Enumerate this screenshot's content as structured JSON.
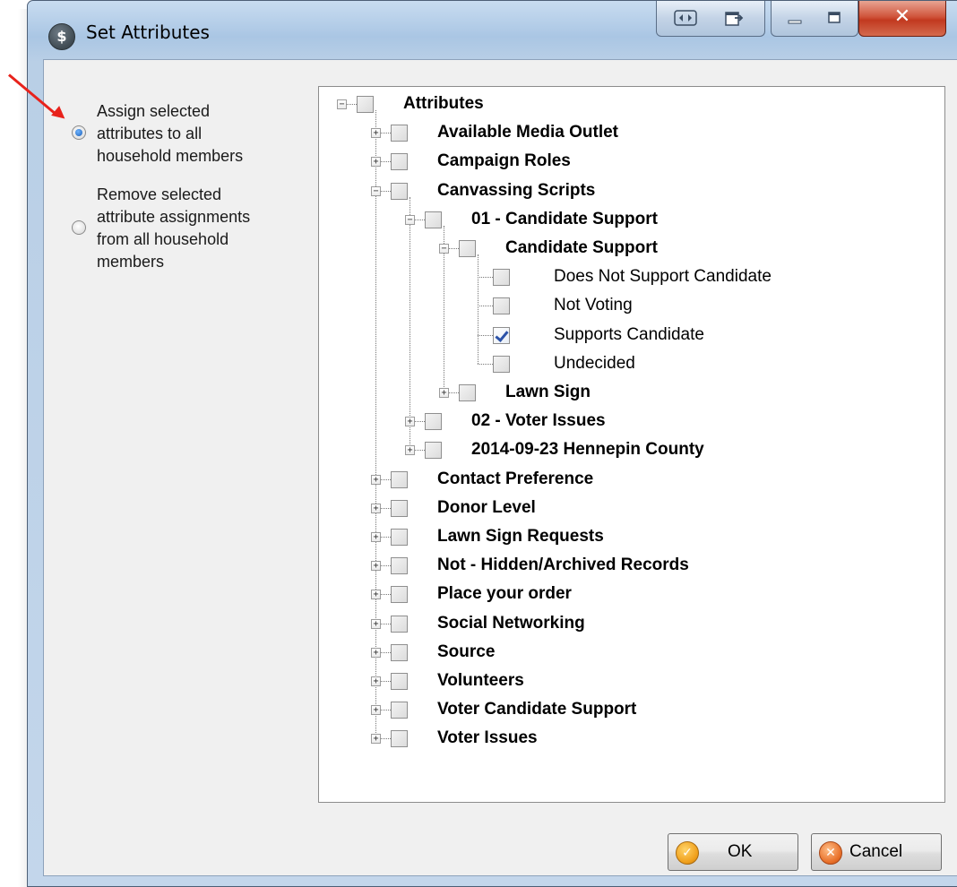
{
  "window": {
    "title": "Set Attributes",
    "app_icon_glyph": "$"
  },
  "options": [
    {
      "label": "Assign selected attributes to all household members",
      "lines": [
        "Assign selected",
        "attributes to all",
        "household members"
      ],
      "checked": true
    },
    {
      "label": "Remove selected attribute assignments from all household members",
      "lines": [
        "Remove selected",
        "attribute assignments",
        "from all household",
        "members"
      ],
      "checked": false
    }
  ],
  "tree": [
    {
      "label": "Attributes",
      "level": 0,
      "expander": "minus",
      "bold": true,
      "checked": false
    },
    {
      "label": "Available Media Outlet",
      "level": 1,
      "expander": "plus",
      "bold": true,
      "checked": false
    },
    {
      "label": "Campaign Roles",
      "level": 1,
      "expander": "plus",
      "bold": true,
      "checked": false
    },
    {
      "label": "Canvassing Scripts",
      "level": 1,
      "expander": "minus",
      "bold": true,
      "checked": false
    },
    {
      "label": "01 - Candidate Support",
      "level": 2,
      "expander": "minus",
      "bold": true,
      "checked": false
    },
    {
      "label": "Candidate Support",
      "level": 3,
      "expander": "minus",
      "bold": true,
      "checked": false
    },
    {
      "label": "Does Not Support Candidate",
      "level": 4,
      "expander": "none",
      "bold": false,
      "checked": false
    },
    {
      "label": "Not Voting",
      "level": 4,
      "expander": "none",
      "bold": false,
      "checked": false
    },
    {
      "label": "Supports Candidate",
      "level": 4,
      "expander": "none",
      "bold": false,
      "checked": true
    },
    {
      "label": "Undecided",
      "level": 4,
      "expander": "none",
      "bold": false,
      "checked": false
    },
    {
      "label": "Lawn Sign",
      "level": 3,
      "expander": "plus",
      "bold": true,
      "checked": false
    },
    {
      "label": "02 - Voter Issues",
      "level": 2,
      "expander": "plus",
      "bold": true,
      "checked": false
    },
    {
      "label": "2014-09-23 Hennepin County",
      "level": 2,
      "expander": "plus",
      "bold": true,
      "checked": false
    },
    {
      "label": "Contact Preference",
      "level": 1,
      "expander": "plus",
      "bold": true,
      "checked": false
    },
    {
      "label": "Donor Level",
      "level": 1,
      "expander": "plus",
      "bold": true,
      "checked": false
    },
    {
      "label": "Lawn Sign Requests",
      "level": 1,
      "expander": "plus",
      "bold": true,
      "checked": false
    },
    {
      "label": "Not - Hidden/Archived Records",
      "level": 1,
      "expander": "plus",
      "bold": true,
      "checked": false
    },
    {
      "label": "Place your order",
      "level": 1,
      "expander": "plus",
      "bold": true,
      "checked": false
    },
    {
      "label": "Social Networking",
      "level": 1,
      "expander": "plus",
      "bold": true,
      "checked": false
    },
    {
      "label": "Source",
      "level": 1,
      "expander": "plus",
      "bold": true,
      "checked": false
    },
    {
      "label": "Volunteers",
      "level": 1,
      "expander": "plus",
      "bold": true,
      "checked": false
    },
    {
      "label": "Voter Candidate Support",
      "level": 1,
      "expander": "plus",
      "bold": true,
      "checked": false
    },
    {
      "label": "Voter Issues",
      "level": 1,
      "expander": "plus",
      "bold": true,
      "checked": false
    }
  ],
  "buttons": {
    "ok": {
      "label": "OK",
      "icon": "check-circle-icon",
      "color": "#f0a01c"
    },
    "cancel": {
      "label": "Cancel",
      "icon": "x-circle-icon",
      "color": "#e8702a"
    }
  },
  "colors": {
    "annotation_arrow": "#e8221b",
    "checkbox_tick": "#2b52a8",
    "close_button": "#c2391f"
  }
}
